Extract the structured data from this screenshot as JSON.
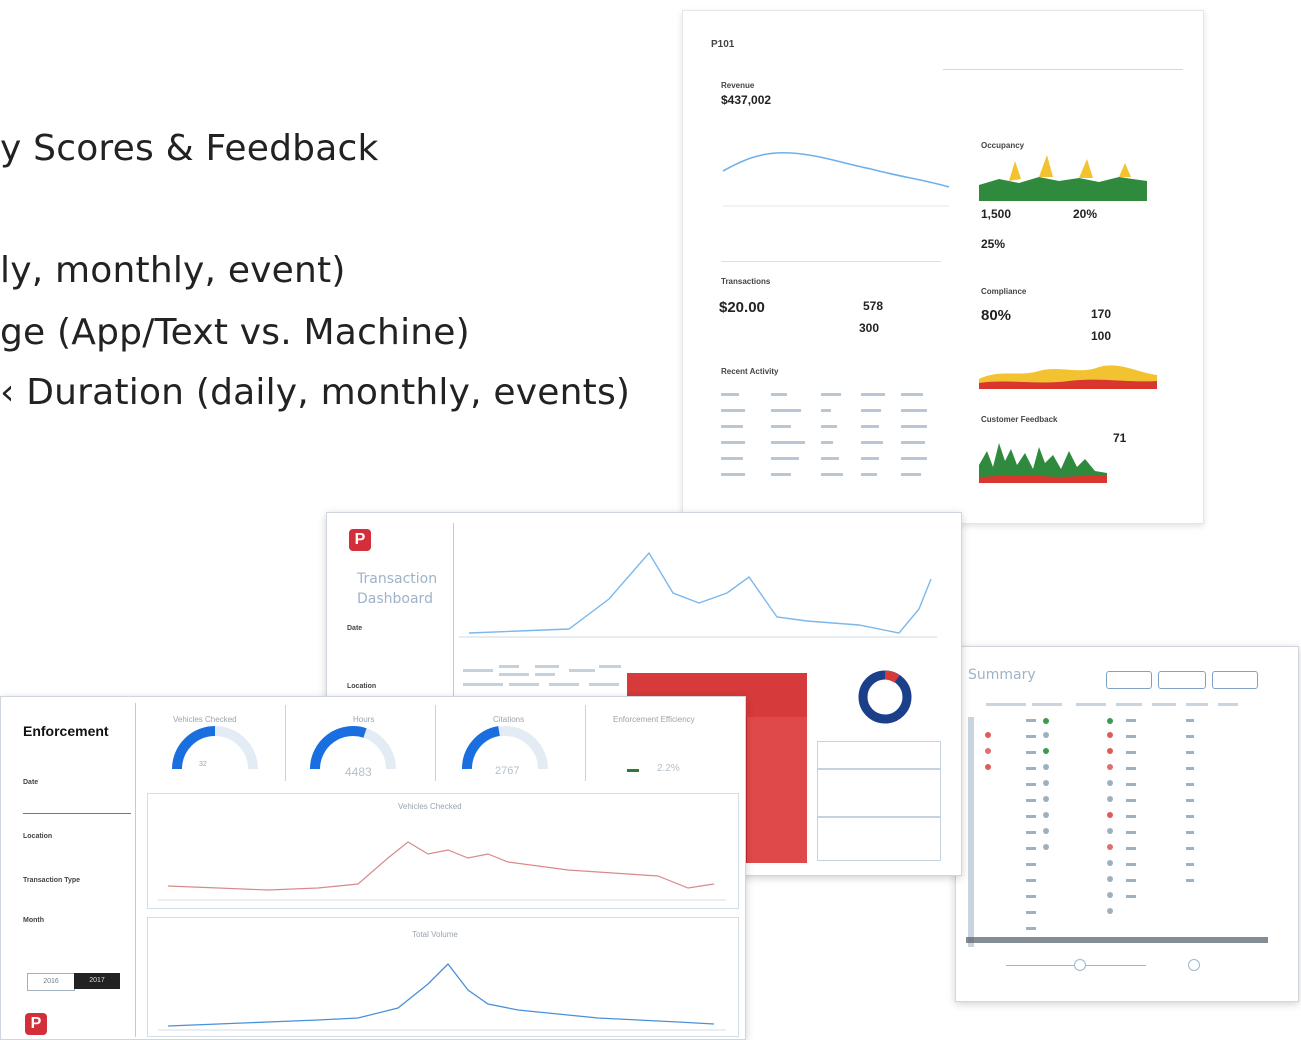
{
  "slide": {
    "bullets": [
      "y Scores & Feedback",
      "ly, monthly, event)",
      "ge (App/Text vs. Machine)",
      "‹ Duration (daily, monthly, events)"
    ]
  },
  "p101": {
    "title": "P101",
    "revenue_label": "Revenue",
    "revenue_value": "$437,002",
    "occupancy_label": "Occupancy",
    "occ_stat1": "1,500",
    "occ_stat2": "20%",
    "occ_stat3": "25%",
    "transactions_label": "Transactions",
    "trans_value1": "$20.00",
    "trans_value2": "578",
    "trans_value3": "300",
    "compliance_label": "Compliance",
    "comp_value1": "80%",
    "comp_value2": "170",
    "comp_value3": "100",
    "activity_label": "Recent Activity",
    "feedback_label": "Customer Feedback",
    "feedback_value": "71"
  },
  "transaction_dash": {
    "logo": "P",
    "title_line1": "Transaction",
    "title_line2": "Dashboard",
    "filter_date": "Date",
    "filter_location": "Location"
  },
  "summary": {
    "title": "Summary"
  },
  "enforcement": {
    "title": "Enforcement",
    "filters": [
      "Date",
      "Location",
      "Transaction Type",
      "Month"
    ],
    "toggle_left": "2016",
    "toggle_right": "2017",
    "logo": "P",
    "kpis": [
      {
        "label": "Vehicles Checked",
        "value": "32"
      },
      {
        "label": "Hours",
        "value": "4483"
      },
      {
        "label": "Citations",
        "value": "2767"
      },
      {
        "label": "Enforcement Efficiency",
        "value": "2.2%"
      }
    ],
    "chart1_title": "Vehicles Checked",
    "chart2_title": "Total Volume"
  },
  "colors": {
    "blue": "#3a8de0",
    "gauge_blue": "#1a6fe0",
    "red": "#d32f3a",
    "pink": "#d98a8a",
    "green": "#2f8a3e",
    "yellow": "#f2c230"
  }
}
